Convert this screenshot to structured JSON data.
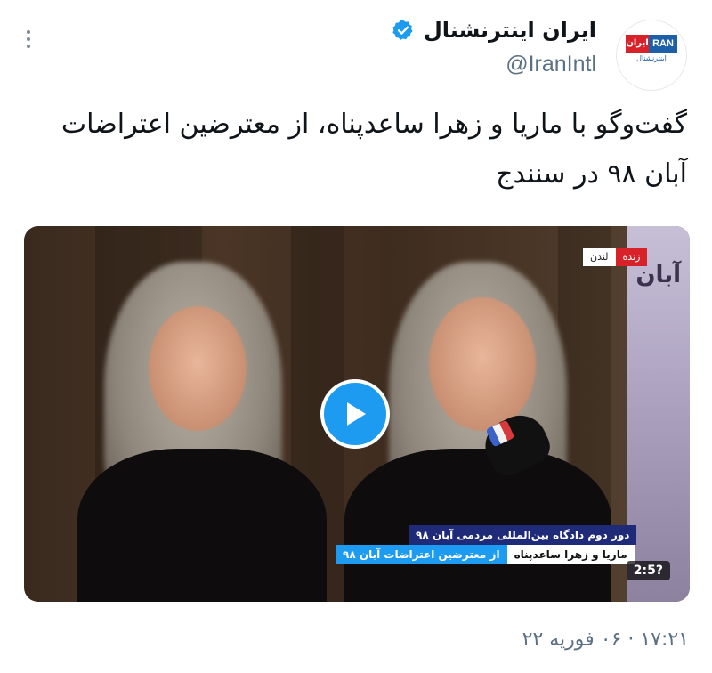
{
  "account": {
    "display_name": "ایران اینترنشنال",
    "handle": "@IranIntl",
    "logo_text_red": "ایران",
    "logo_text_blue": "RAN",
    "logo_subtitle": "اینترنشنال",
    "verified_icon": "verified-badge-icon"
  },
  "tweet": {
    "text_line1": "گفت‌وگو با ماریا و زهرا ساعدپناه، از معترضین اعتراضات",
    "text_line2": "آبان ۹۸  در سنندج",
    "timestamp": "۱۷:۲۱ · ۰۶ فوریه ۲۲"
  },
  "video": {
    "live_city": "لندن",
    "live_tag": "زنده",
    "lower_third_title": "دور دوم دادگاه بین‌المللی مردمی آبان ۹۸",
    "lower_third_name": "ماریا و زهرا ساعدپناه",
    "lower_third_desc": "از معترضین اعتراضات آبان ۹۸",
    "poster_text": "آبان",
    "duration": "2:5?"
  },
  "colors": {
    "accent": "#1d9bf0",
    "brand_red": "#d62228",
    "brand_blue": "#1d5fa8",
    "muted_text": "#5b7083"
  }
}
